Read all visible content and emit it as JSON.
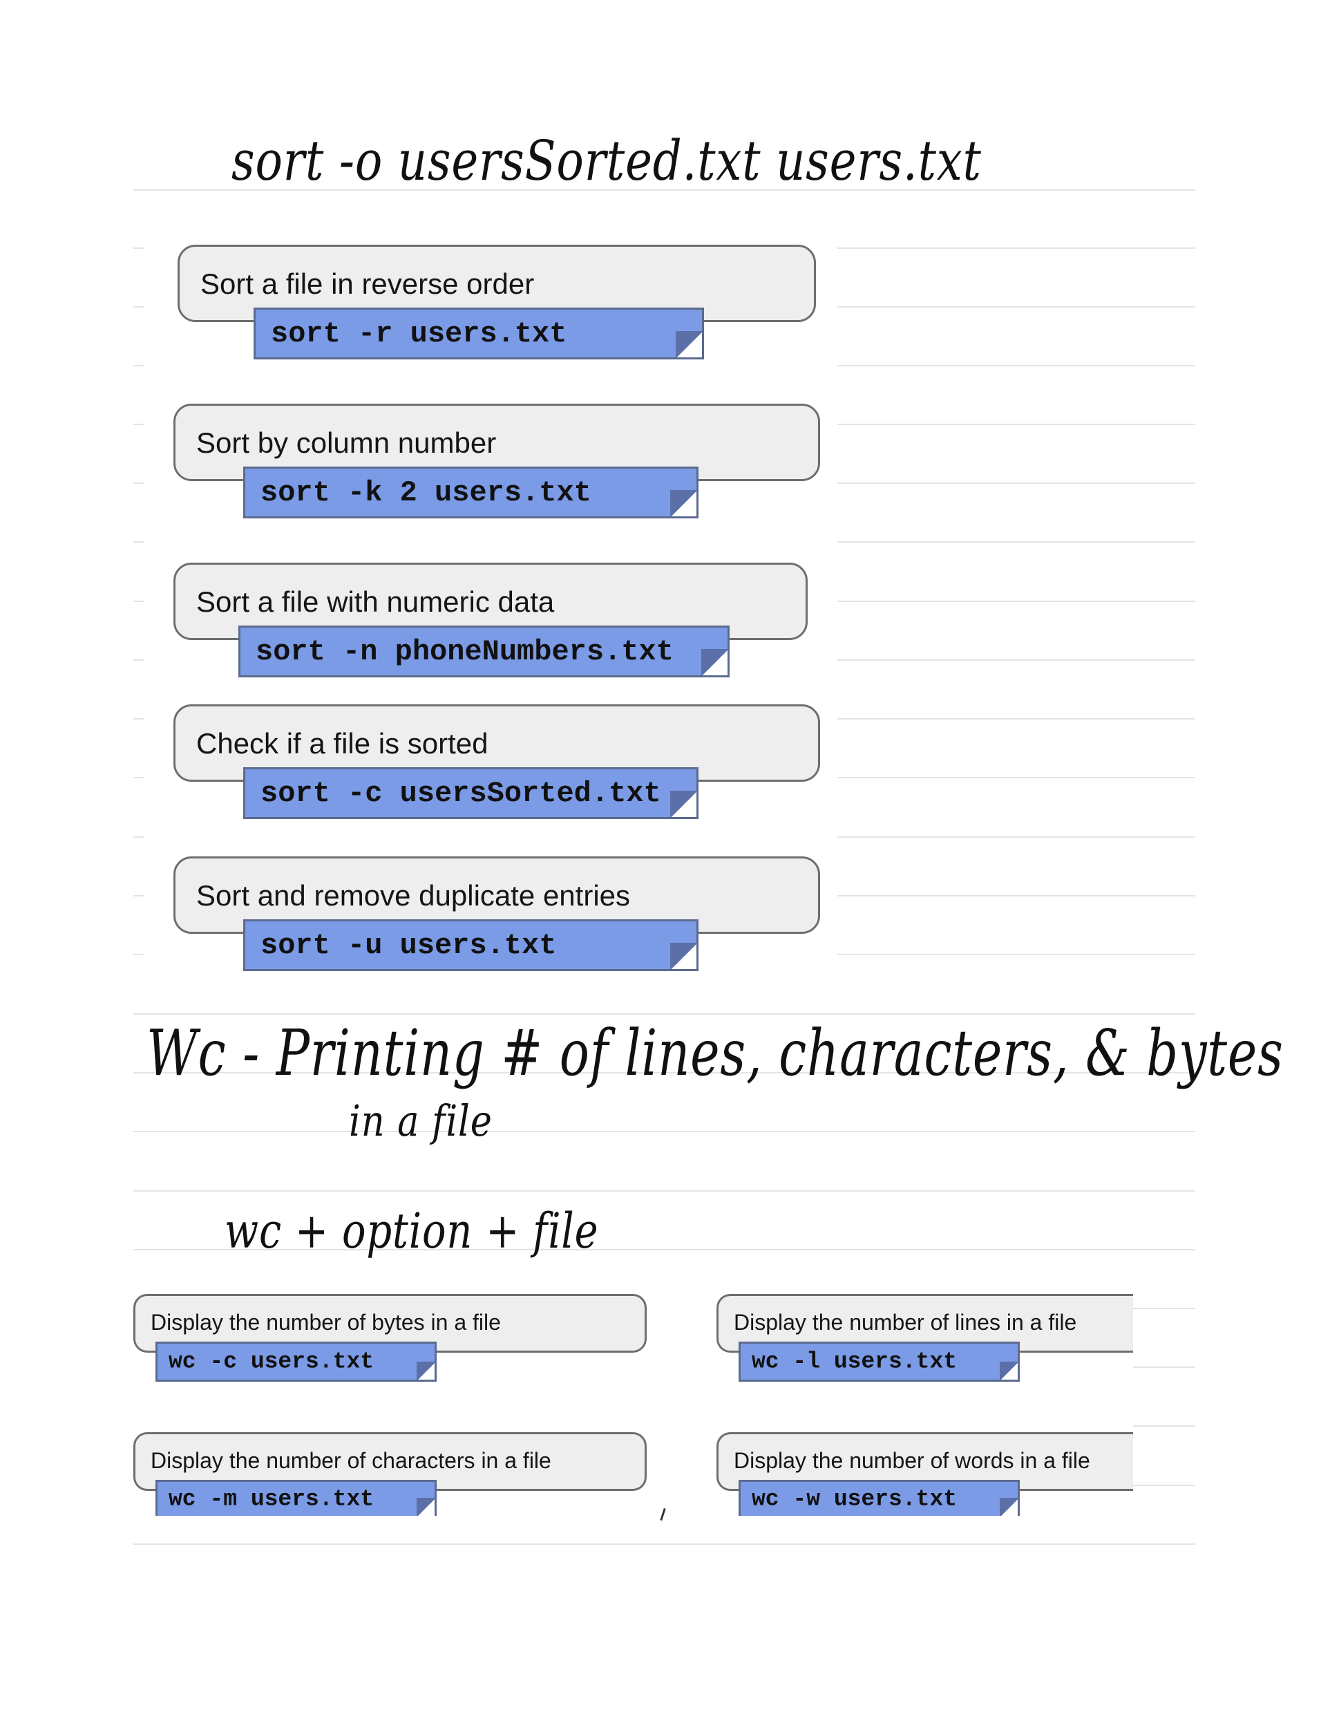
{
  "handwriting": {
    "sort_output": "sort -o usersSorted.txt users.txt",
    "wc_heading": "Wc - Printing # of lines, characters, & bytes",
    "wc_heading_cont": "in a file",
    "wc_syntax": "wc + option + file"
  },
  "sort_cards": [
    {
      "description": "Sort a file in reverse order",
      "command": "sort -r users.txt"
    },
    {
      "description": "Sort by column number",
      "command": "sort -k 2 users.txt"
    },
    {
      "description": "Sort a file with numeric data",
      "command": "sort -n phoneNumbers.txt"
    },
    {
      "description": "Check if a file is sorted",
      "command": "sort -c usersSorted.txt"
    },
    {
      "description": "Sort and remove duplicate entries",
      "command": "sort -u users.txt"
    }
  ],
  "wc_cards": [
    {
      "description": "Display the number of bytes in a file",
      "command": "wc -c users.txt"
    },
    {
      "description": "Display the number of lines in a file",
      "command": "wc -l users.txt"
    },
    {
      "description": "Display the number of characters in a file",
      "command": "wc -m users.txt"
    },
    {
      "description": "Display the number of words in a file",
      "command": "wc -w users.txt"
    }
  ]
}
